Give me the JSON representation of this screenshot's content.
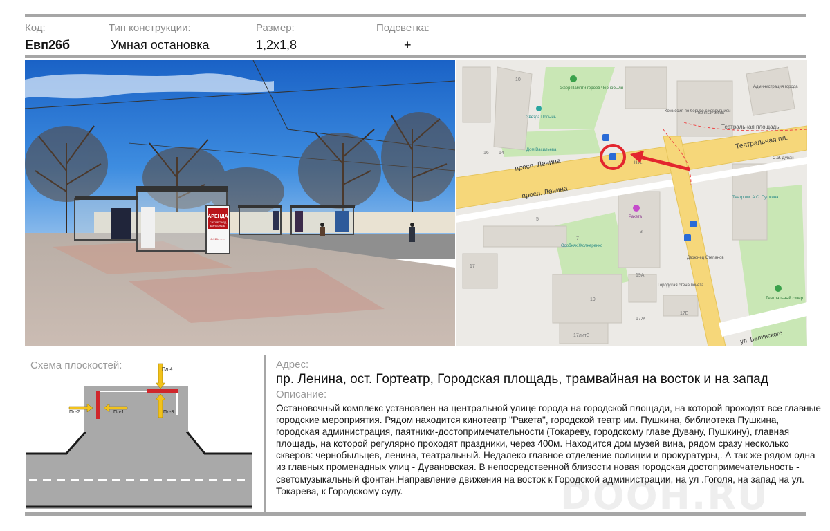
{
  "header": {
    "code_label": "Код:",
    "type_label": "Тип конструкции:",
    "size_label": "Размер:",
    "light_label": "Подсветка:",
    "code_value": "Евп26б",
    "type_value": "Умная остановка",
    "size_value": "1,2х1,8",
    "light_value": "+"
  },
  "photo": {
    "banner_title": "АРЕНДА",
    "banner_line1": "СИТИБОАРД",
    "banner_line2": "БИЛБОРДЫ",
    "banner_phone": "8-918-…-…"
  },
  "map": {
    "street_lenina_1": "просп. Ленина",
    "street_lenina_2": "просп. Ленина",
    "street_teatralnaya": "Театральная пл.",
    "area_teatralnaya": "Театральная площадь",
    "street_belinskogo": "ул. Белинского",
    "poi_skver": "сквер Памяти героев Чернобыля",
    "poi_admin": "Администрация города",
    "poi_commission": "Комиссия по борьбе с коррупцией",
    "poi_eternal_fire": "Вечный огонь",
    "poi_star": "Звезда Полынь",
    "poi_vasilyev": "Дом Васильева",
    "poi_theatre": "Театр им. А.С. Пушкина",
    "poi_dubanu": "С.Э. Дуван",
    "poi_raketa": "Ракета",
    "poi_osobnyak": "Особняк Жолнеренко",
    "poi_stepanov": "Двоюнец Степанов",
    "poi_wall": "Городская стена почёта",
    "poi_theatre_sq": "Театральный сквер",
    "poi_na": "Н.А.",
    "b_10": "10",
    "b_14": "14",
    "b_16": "16",
    "b_5": "5",
    "b_3": "3",
    "b_7": "7",
    "b_17": "17",
    "b_19a": "19А",
    "b_19": "19",
    "b_17zh": "17Ж",
    "b_17b": "17Б",
    "b_17lit": "17литЗ"
  },
  "scheme": {
    "title": "Схема плоскостей:",
    "pl1": "Пл-1",
    "pl2": "Пл-2",
    "pl3": "Пл-3",
    "pl4": "Пл-4"
  },
  "address": {
    "label": "Адрес:",
    "text": "пр. Ленина, ост. Гортеатр, Городская площадь, трамвайная на восток и на запад"
  },
  "description": {
    "label": "Описание:",
    "text": "Остановочный комплекс установлен на центральной улице города на городской площади, на которой проходят все главные городские мероприятия. Рядом находится кинотеатр \"Ракета\", городской театр им. Пушкина, библиотека Пушкина, городская администрация, паятники-достопримечательности (Токареву, городскому главе Дувану, Пушкину), главная площадь, на которой регулярно проходят праздники, через 400м. Находится дом музей вина, рядом сразу несколько скверов: чернобыльцев, ленина, театральный. Недалеко главное отделение полиции и прокуратуры,. А так же рядом одна из главных променадных улиц - Дувановская. В непосредственной близости новая городская достопримечательность -  светомузыкальный фонтан.Направление движения на восток  к Городской администрации, на ул .Гоголя, на запад на ул. Токарева, к Городскому суду."
  },
  "watermark": "DOOH.RU",
  "colors": {
    "rule": "#a6a6a6",
    "sky": "#1f6fd0",
    "pavement": "#c9b2a4",
    "plane_red": "#d0262b",
    "arrow_yellow": "#f2c21b",
    "map_road": "#f6d77a",
    "map_park": "#c9e7b5",
    "map_marker": "#e3262e"
  }
}
